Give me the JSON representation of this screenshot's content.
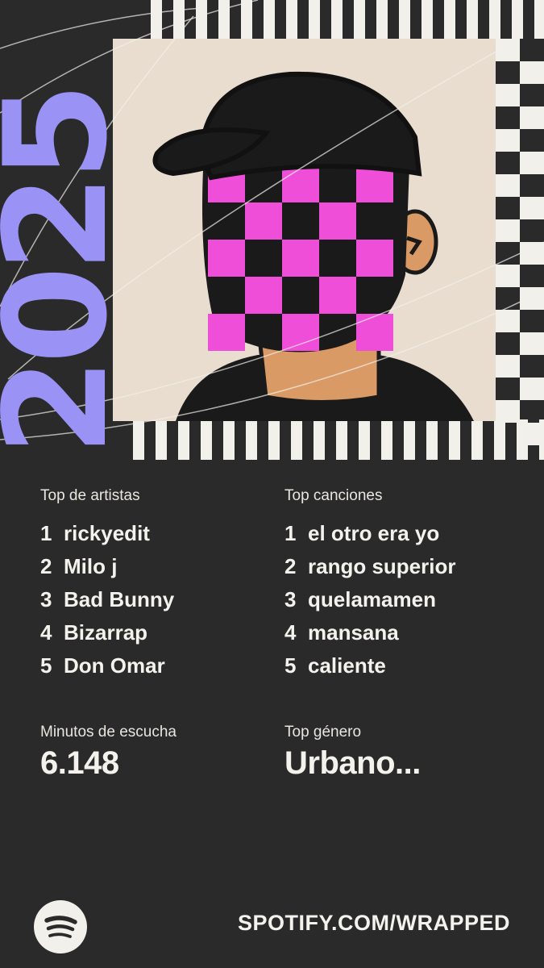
{
  "artwork": {
    "year": "2025",
    "accent_color": "#9a93f5",
    "mask_color": "#ef4fd8",
    "card_color": "#e8ddcf",
    "skin_color": "#d99a66",
    "cap_color": "#1a1a1a",
    "stripe_color": "#f2f0ea"
  },
  "top_artists": {
    "label": "Top de artistas",
    "items": [
      {
        "rank": "1",
        "name": "rickyedit"
      },
      {
        "rank": "2",
        "name": "Milo j"
      },
      {
        "rank": "3",
        "name": "Bad Bunny"
      },
      {
        "rank": "4",
        "name": "Bizarrap"
      },
      {
        "rank": "5",
        "name": "Don Omar"
      }
    ]
  },
  "top_songs": {
    "label": "Top canciones",
    "items": [
      {
        "rank": "1",
        "name": "el otro era yo"
      },
      {
        "rank": "2",
        "name": "rango superior"
      },
      {
        "rank": "3",
        "name": "quelamamen"
      },
      {
        "rank": "4",
        "name": "mansana"
      },
      {
        "rank": "5",
        "name": "caliente"
      }
    ]
  },
  "minutes": {
    "label": "Minutos de escucha",
    "value": "6.148"
  },
  "genre": {
    "label": "Top género",
    "value": "Urbano..."
  },
  "footer": {
    "logo_icon": "spotify-logo-icon",
    "url": "SPOTIFY.COM/WRAPPED"
  }
}
